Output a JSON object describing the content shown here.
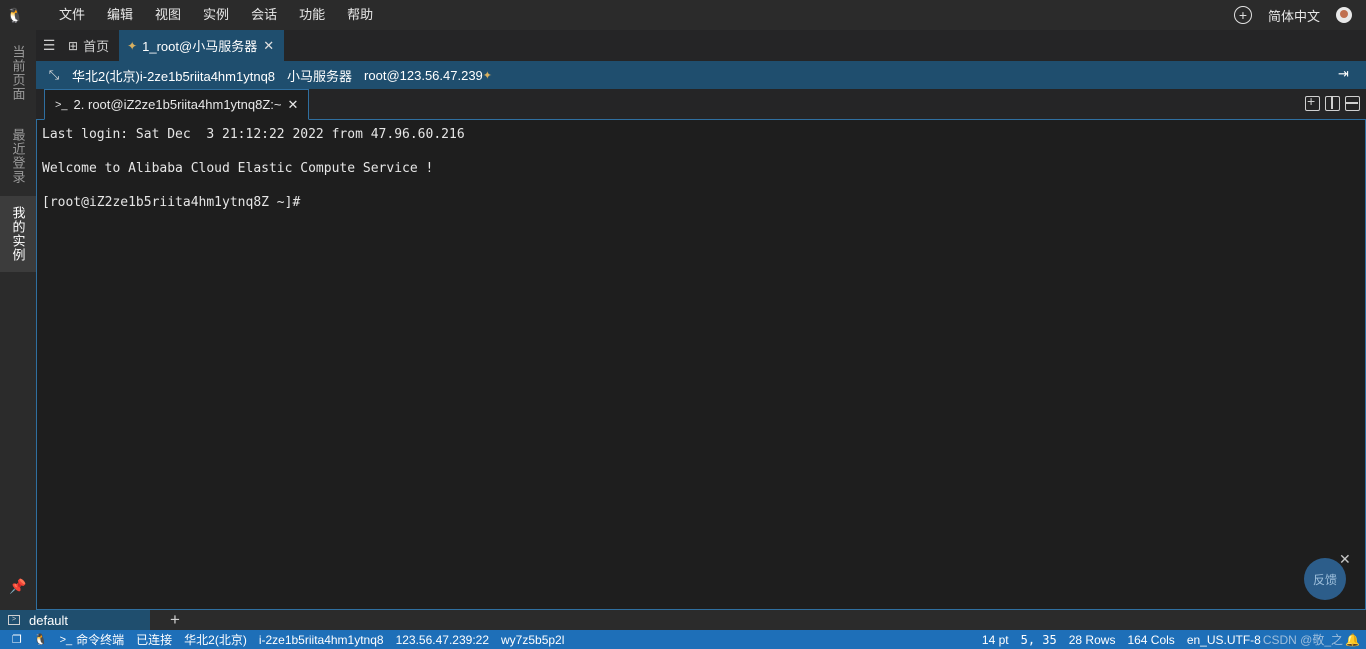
{
  "menubar": {
    "items": [
      "文件",
      "编辑",
      "视图",
      "实例",
      "会话",
      "功能",
      "帮助"
    ],
    "language": "简体中文"
  },
  "leftbar": {
    "tabs": [
      "当前页面",
      "最近登录",
      "我的实例"
    ]
  },
  "tabs": {
    "home": "首页",
    "server": "1_root@小马服务器"
  },
  "infobar": {
    "region_instance": "华北2(北京)i-2ze1b5riita4hm1ytnq8",
    "server_name": "小马服务器",
    "address": "root@123.56.47.239"
  },
  "terminal_tab": {
    "label": "2. root@iZ2ze1b5riita4hm1ytnq8Z:~"
  },
  "terminal": {
    "lines": [
      "Last login: Sat Dec  3 21:12:22 2022 from 47.96.60.216",
      "",
      "Welcome to Alibaba Cloud Elastic Compute Service !",
      "",
      "[root@iZ2ze1b5riita4hm1ytnq8Z ~]#"
    ]
  },
  "feedback": "反馈",
  "panel": {
    "tab": "default"
  },
  "statusbar": {
    "left": [
      "命令终端",
      "已连接",
      "华北2(北京)",
      "i-2ze1b5riita4hm1ytnq8",
      "123.56.47.239:22",
      "wy7z5b5p2l"
    ],
    "font_size": "14 pt",
    "cursor": "5, 35",
    "rows": "28 Rows",
    "cols": "164 Cols",
    "encoding": "en_US.UTF-8",
    "watermark": "CSDN @敬_之"
  },
  "colors": {
    "accent": "#1e6fb8",
    "tab_active": "#1f4e6e",
    "background": "#1e1e1e"
  }
}
